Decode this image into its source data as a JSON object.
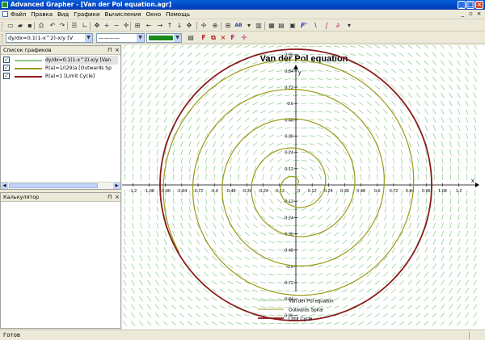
{
  "window": {
    "title": "Advanced Grapher - [Van der Pol equation.agr]",
    "min_glyph": "_",
    "max_glyph": "□",
    "close_glyph": "×"
  },
  "menu": {
    "items": [
      "Файл",
      "Правка",
      "Вид",
      "Графики",
      "Вычисления",
      "Окно",
      "Помощь"
    ],
    "mdi_glyphs": [
      "_",
      "▫",
      "×"
    ]
  },
  "toolbar1": {
    "icons": [
      {
        "name": "new-icon",
        "glyph": "▭"
      },
      {
        "name": "open-icon",
        "glyph": "▰"
      },
      {
        "name": "save-icon",
        "glyph": "▪"
      },
      {
        "name": "print-icon",
        "glyph": "⎙"
      },
      {
        "name": "undo-icon",
        "glyph": "↶"
      },
      {
        "name": "redo-icon",
        "glyph": "↷"
      },
      {
        "name": "list-icon",
        "glyph": "☰"
      },
      {
        "name": "axes-icon",
        "glyph": "∟"
      },
      {
        "name": "move-icon",
        "glyph": "✥"
      },
      {
        "name": "zoom-in-icon",
        "glyph": "+"
      },
      {
        "name": "zoom-out-icon",
        "glyph": "−"
      },
      {
        "name": "center-icon",
        "glyph": "✛"
      },
      {
        "name": "fit-icon",
        "glyph": "⊞"
      },
      {
        "name": "left-icon",
        "glyph": "←"
      },
      {
        "name": "right-icon",
        "glyph": "→"
      },
      {
        "name": "up-icon",
        "glyph": "↑"
      },
      {
        "name": "down-icon",
        "glyph": "↓"
      },
      {
        "name": "pan-icon",
        "glyph": "✥"
      },
      {
        "name": "crosshair-icon",
        "glyph": "✢"
      },
      {
        "name": "zoom-tool-icon",
        "glyph": "⊕"
      },
      {
        "name": "grid-icon",
        "glyph": "⊞"
      },
      {
        "name": "text-icon",
        "glyph": "AB"
      },
      {
        "name": "dropdown-icon",
        "glyph": "▾"
      },
      {
        "name": "table-icon",
        "glyph": "▥"
      },
      {
        "name": "graph-icon",
        "glyph": "▦"
      },
      {
        "name": "calc-icon",
        "glyph": "▤"
      },
      {
        "name": "format-icon",
        "glyph": "▣"
      },
      {
        "name": "function-icon",
        "glyph": "F'"
      },
      {
        "name": "tangent-icon",
        "glyph": "∖"
      },
      {
        "name": "integral-icon",
        "glyph": "∫"
      },
      {
        "name": "derivative-icon",
        "glyph": "∂"
      },
      {
        "name": "more-icon",
        "glyph": "▾"
      }
    ]
  },
  "toolbar2": {
    "graph_combo": "dy/dx=0.1(1-x^2)-x/y [V",
    "line_style_combo": "————",
    "color_combo": "green",
    "icons": [
      {
        "name": "properties-icon",
        "glyph": "▤"
      },
      {
        "name": "add-graph-icon",
        "glyph": "F"
      },
      {
        "name": "copy-graph-icon",
        "glyph": "⧉"
      },
      {
        "name": "delete-graph-icon",
        "glyph": "×"
      },
      {
        "name": "fx-icon",
        "glyph": "F"
      },
      {
        "name": "pin-icon",
        "glyph": "✢"
      }
    ]
  },
  "graph_list": {
    "title": "Список графиков",
    "pin_glyph": "⊓",
    "close_glyph": "×",
    "items": [
      {
        "label": "dy/dx=0.1(1-x^2)-x/y [Van",
        "color": "#8cc88c",
        "checked": true,
        "selected": true
      },
      {
        "label": "R(a)=1/(29)a [Outwards Sp",
        "color": "#9a9a18",
        "checked": true,
        "selected": false
      },
      {
        "label": "R(a)=1 [Limit Cycle]",
        "color": "#8b1a1a",
        "checked": true,
        "selected": false
      }
    ],
    "check_glyph": "✓"
  },
  "calculator": {
    "title": "Калькулятор",
    "pin_glyph": "⊓",
    "close_glyph": "×"
  },
  "status": {
    "text": "Готов"
  },
  "colors": {
    "slope_field": "#8cc88c",
    "spiral": "#9a9a18",
    "limit_cycle": "#8b1a1a",
    "axis": "#000000"
  },
  "chart_data": {
    "type": "line",
    "title": "Van der Pol equation",
    "xlabel": "x",
    "ylabel": "y",
    "xlim": [
      -1.26,
      1.26
    ],
    "ylim": [
      -1.26,
      1.26
    ],
    "x_ticks": [
      "-1.2",
      "-1.08",
      "-0.96",
      "-0.84",
      "-0.72",
      "-0.6",
      "-0.48",
      "-0.36",
      "-0.24",
      "-0.12",
      "0.12",
      "0.24",
      "0.36",
      "0.48",
      "0.6",
      "0.72",
      "0.84",
      "0.96",
      "1.08",
      "1.2"
    ],
    "y_ticks": [
      "1.2",
      "1.08",
      "0.96",
      "0.84",
      "0.72",
      "0.6",
      "0.48",
      "0.36",
      "0.24",
      "0.12",
      "-0.12",
      "-0.24",
      "-0.36",
      "-0.48",
      "-0.6",
      "-0.72",
      "-0.84",
      "-0.96",
      "-1.08",
      "-1.2"
    ],
    "origin_label": "0",
    "series": [
      {
        "name": "Van der Pol equation",
        "kind": "slope-field",
        "equation": "dy/dx=0.1(1-x^2)-x/y"
      },
      {
        "name": "Outwards Spiral",
        "kind": "polar",
        "equation": "R(a)=1/(29)a",
        "a_max": 28.8
      },
      {
        "name": "Limit Cycle",
        "kind": "polar",
        "equation": "R(a)=1",
        "radius": 1
      }
    ],
    "legend_position": "bottom"
  }
}
